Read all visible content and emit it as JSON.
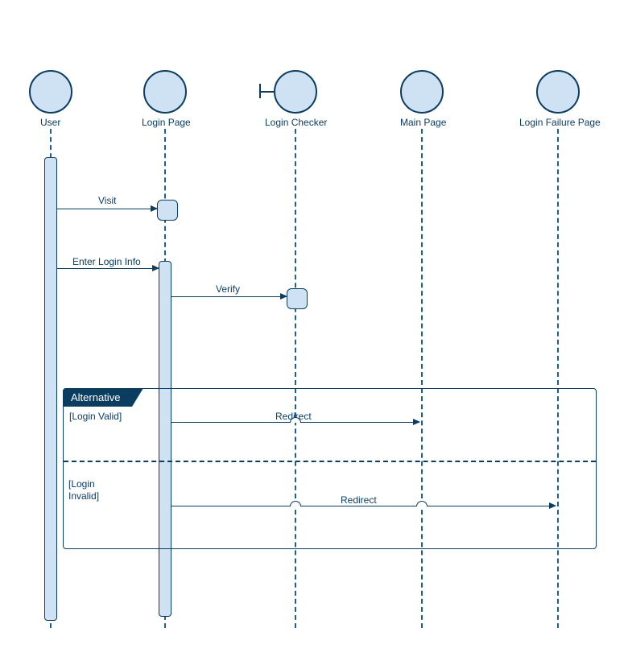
{
  "colors": {
    "fill": "#cfe2f3",
    "stroke": "#0b3d61",
    "white": "#ffffff"
  },
  "actors": [
    {
      "name": "User"
    },
    {
      "name": "Login Page"
    },
    {
      "name": "Login Checker"
    },
    {
      "name": "Main Page"
    },
    {
      "name": "Login Failure Page"
    }
  ],
  "messages": {
    "visit": "Visit",
    "enter": "Enter Login Info",
    "verify": "Verify",
    "redirect1": "Redirect",
    "redirect2": "Redirect"
  },
  "fragment": {
    "type": "Alternative",
    "guard_valid": "[Login Valid]",
    "guard_invalid_l1": "[Login",
    "guard_invalid_l2": "Invalid]"
  }
}
